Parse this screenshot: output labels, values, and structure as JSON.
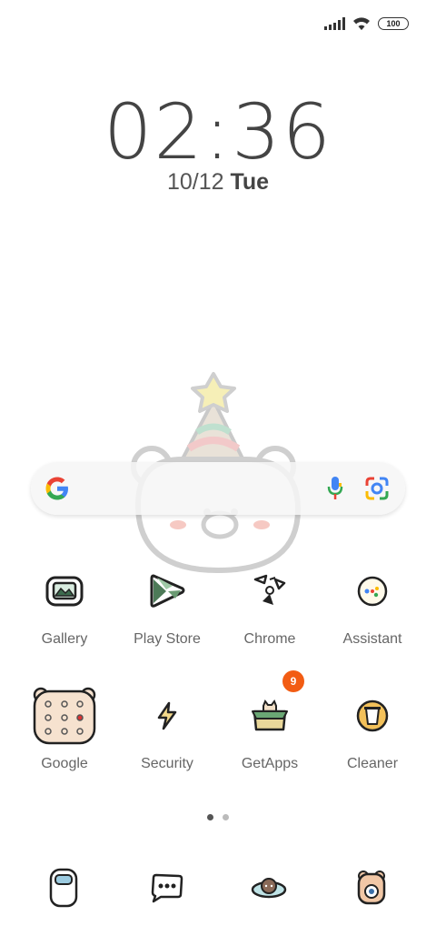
{
  "status_bar": {
    "battery": "100"
  },
  "clock": {
    "time": "02:36",
    "date": "10/12",
    "day": "Tue"
  },
  "search": {
    "provider_icon": "google-g-icon",
    "mic_icon": "mic-icon",
    "lens_icon": "lens-icon"
  },
  "apps": [
    {
      "label": "Gallery",
      "icon": "gallery-icon"
    },
    {
      "label": "Play Store",
      "icon": "play-store-icon"
    },
    {
      "label": "Chrome",
      "icon": "chrome-icon"
    },
    {
      "label": "Assistant",
      "icon": "assistant-icon"
    },
    {
      "label": "Google",
      "icon": "google-folder-icon"
    },
    {
      "label": "Security",
      "icon": "security-icon"
    },
    {
      "label": "GetApps",
      "icon": "getapps-icon",
      "badge": "9"
    },
    {
      "label": "Cleaner",
      "icon": "cleaner-icon"
    }
  ],
  "page_indicator": {
    "pages": 2,
    "active": 1
  },
  "dock": [
    {
      "icon": "phone-icon"
    },
    {
      "icon": "messages-icon"
    },
    {
      "icon": "browser-icon"
    },
    {
      "icon": "camera-icon"
    }
  ],
  "colors": {
    "badge": "#f25c13",
    "label": "#666666",
    "clock": "#444444"
  }
}
